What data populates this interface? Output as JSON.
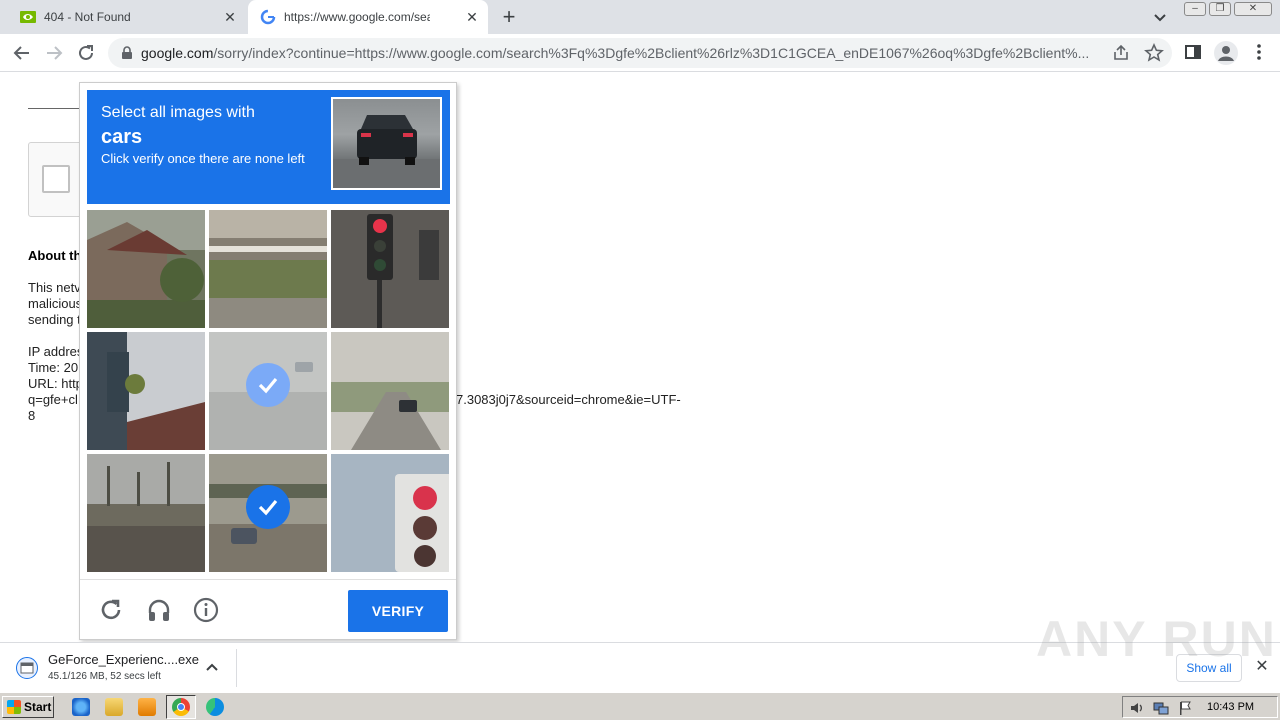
{
  "browser": {
    "tabs": [
      {
        "title": "404 - Not Found",
        "favicon": "nvidia-logo"
      },
      {
        "title": "https://www.google.com/search?q=",
        "favicon": "google-g-logo",
        "active": true
      }
    ],
    "url_host": "google.com",
    "url_rest": "/sorry/index?continue=https://www.google.com/search%3Fq%3Dgfe%2Bclient%26rlz%3D1C1GCEA_enDE1067%26oq%3Dgfe%2Bclient%..."
  },
  "page": {
    "about_title": "About th",
    "para_lines": [
      "This netv",
      "malicious",
      "sending t"
    ],
    "info_lines": [
      "IP addres",
      "Time: 20:",
      "URL: http",
      "q=gfe+cl",
      "8"
    ],
    "url_tail": "7.3083j0j7&sourceid=chrome&ie=UTF-"
  },
  "captcha": {
    "line1": "Select all images with",
    "target": "cars",
    "line3": "Click verify once there are none left",
    "verify_label": "VERIFY",
    "tiles": [
      {
        "scene": "house-with-trees",
        "selected": false
      },
      {
        "scene": "bridge-river",
        "selected": false
      },
      {
        "scene": "traffic-light-red",
        "selected": false
      },
      {
        "scene": "house-steps",
        "selected": false
      },
      {
        "scene": "street-car-faded",
        "selected": true
      },
      {
        "scene": "road-with-car",
        "selected": false
      },
      {
        "scene": "palm-trees-road",
        "selected": false
      },
      {
        "scene": "road-car-bridge",
        "selected": true
      },
      {
        "scene": "traffic-light-closeup",
        "selected": false
      }
    ],
    "colors": {
      "header": "#1a73e8",
      "check_active": "#1a73e8",
      "check_faded": "#7baaf7"
    }
  },
  "downloads": {
    "file_name": "GeForce_Experienc....exe",
    "status": "45.1/126 MB, 52 secs left",
    "show_all": "Show all"
  },
  "watermark": "ANY RUN",
  "taskbar": {
    "start_label": "Start",
    "clock": "10:43 PM"
  }
}
